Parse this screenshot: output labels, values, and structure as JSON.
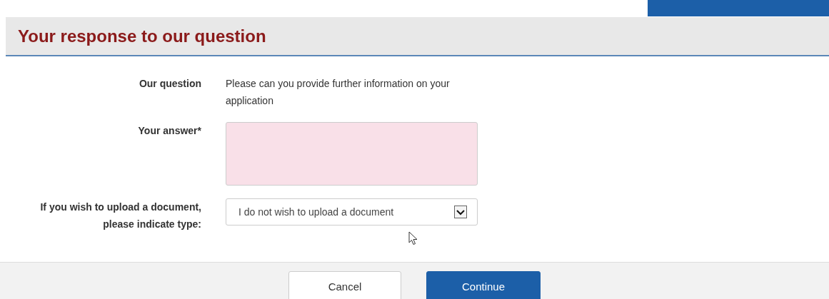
{
  "header": {
    "title": "Your response to our question"
  },
  "form": {
    "question_label": "Our question",
    "question_text": "Please can you provide further information on your application",
    "answer_label": "Your answer*",
    "answer": {
      "invalid": true
    },
    "upload_label": "If you wish to upload a document, please indicate type:",
    "upload_select": {
      "value": "I do not wish to upload a document"
    }
  },
  "buttons": [
    {
      "label": "Cancel",
      "kind": "secondary"
    },
    {
      "label": "Continue",
      "kind": "primary"
    }
  ]
}
